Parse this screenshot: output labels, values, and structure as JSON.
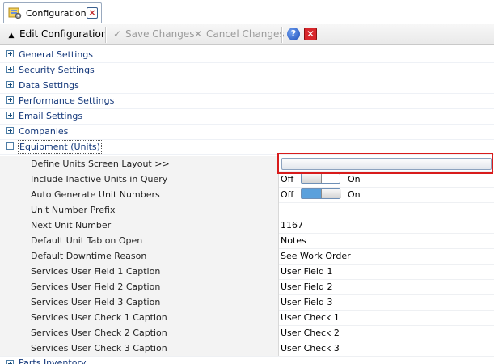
{
  "tab": {
    "label": "Configuration",
    "close_glyph": "×",
    "icon": "configuration-icon"
  },
  "toolbar": {
    "edit_label": "Edit Configuration",
    "edit_glyph": "▲",
    "save_label": "Save Changes",
    "save_glyph": "✓",
    "cancel_label": "Cancel Changes",
    "cancel_glyph": "✕",
    "help_glyph": "?",
    "exit_glyph": "✕"
  },
  "categories": [
    "General Settings",
    "Security Settings",
    "Data Settings",
    "Performance Settings",
    "Email Settings",
    "Companies",
    "Equipment (Units)"
  ],
  "next_category": "Parts Inventory",
  "equipment": {
    "define_layout": {
      "name": "Define Units Screen Layout >>"
    },
    "include_inactive": {
      "name": "Include Inactive Units in Query",
      "off_label": "Off",
      "on_label": "On",
      "state": "off"
    },
    "auto_generate": {
      "name": "Auto Generate Unit Numbers",
      "off_label": "Off",
      "on_label": "On",
      "state": "on"
    },
    "rows": [
      {
        "name": "Unit Number Prefix",
        "value": ""
      },
      {
        "name": "Next Unit Number",
        "value": "1167"
      },
      {
        "name": "Default Unit Tab on Open",
        "value": "Notes"
      },
      {
        "name": "Default Downtime Reason",
        "value": "See Work Order"
      },
      {
        "name": "Services User Field 1 Caption",
        "value": "User Field 1"
      },
      {
        "name": "Services User Field 2 Caption",
        "value": "User Field 2"
      },
      {
        "name": "Services User Field 3 Caption",
        "value": "User Field 3"
      },
      {
        "name": "Services User Check 1 Caption",
        "value": "User Check 1"
      },
      {
        "name": "Services User Check 2 Caption",
        "value": "User Check 2"
      },
      {
        "name": "Services User Check 3 Caption",
        "value": "User Check 3"
      }
    ]
  },
  "colors": {
    "category_text": "#13377a",
    "focus_outline": "#d81b1b",
    "toggle_on": "#5aa0dc"
  }
}
